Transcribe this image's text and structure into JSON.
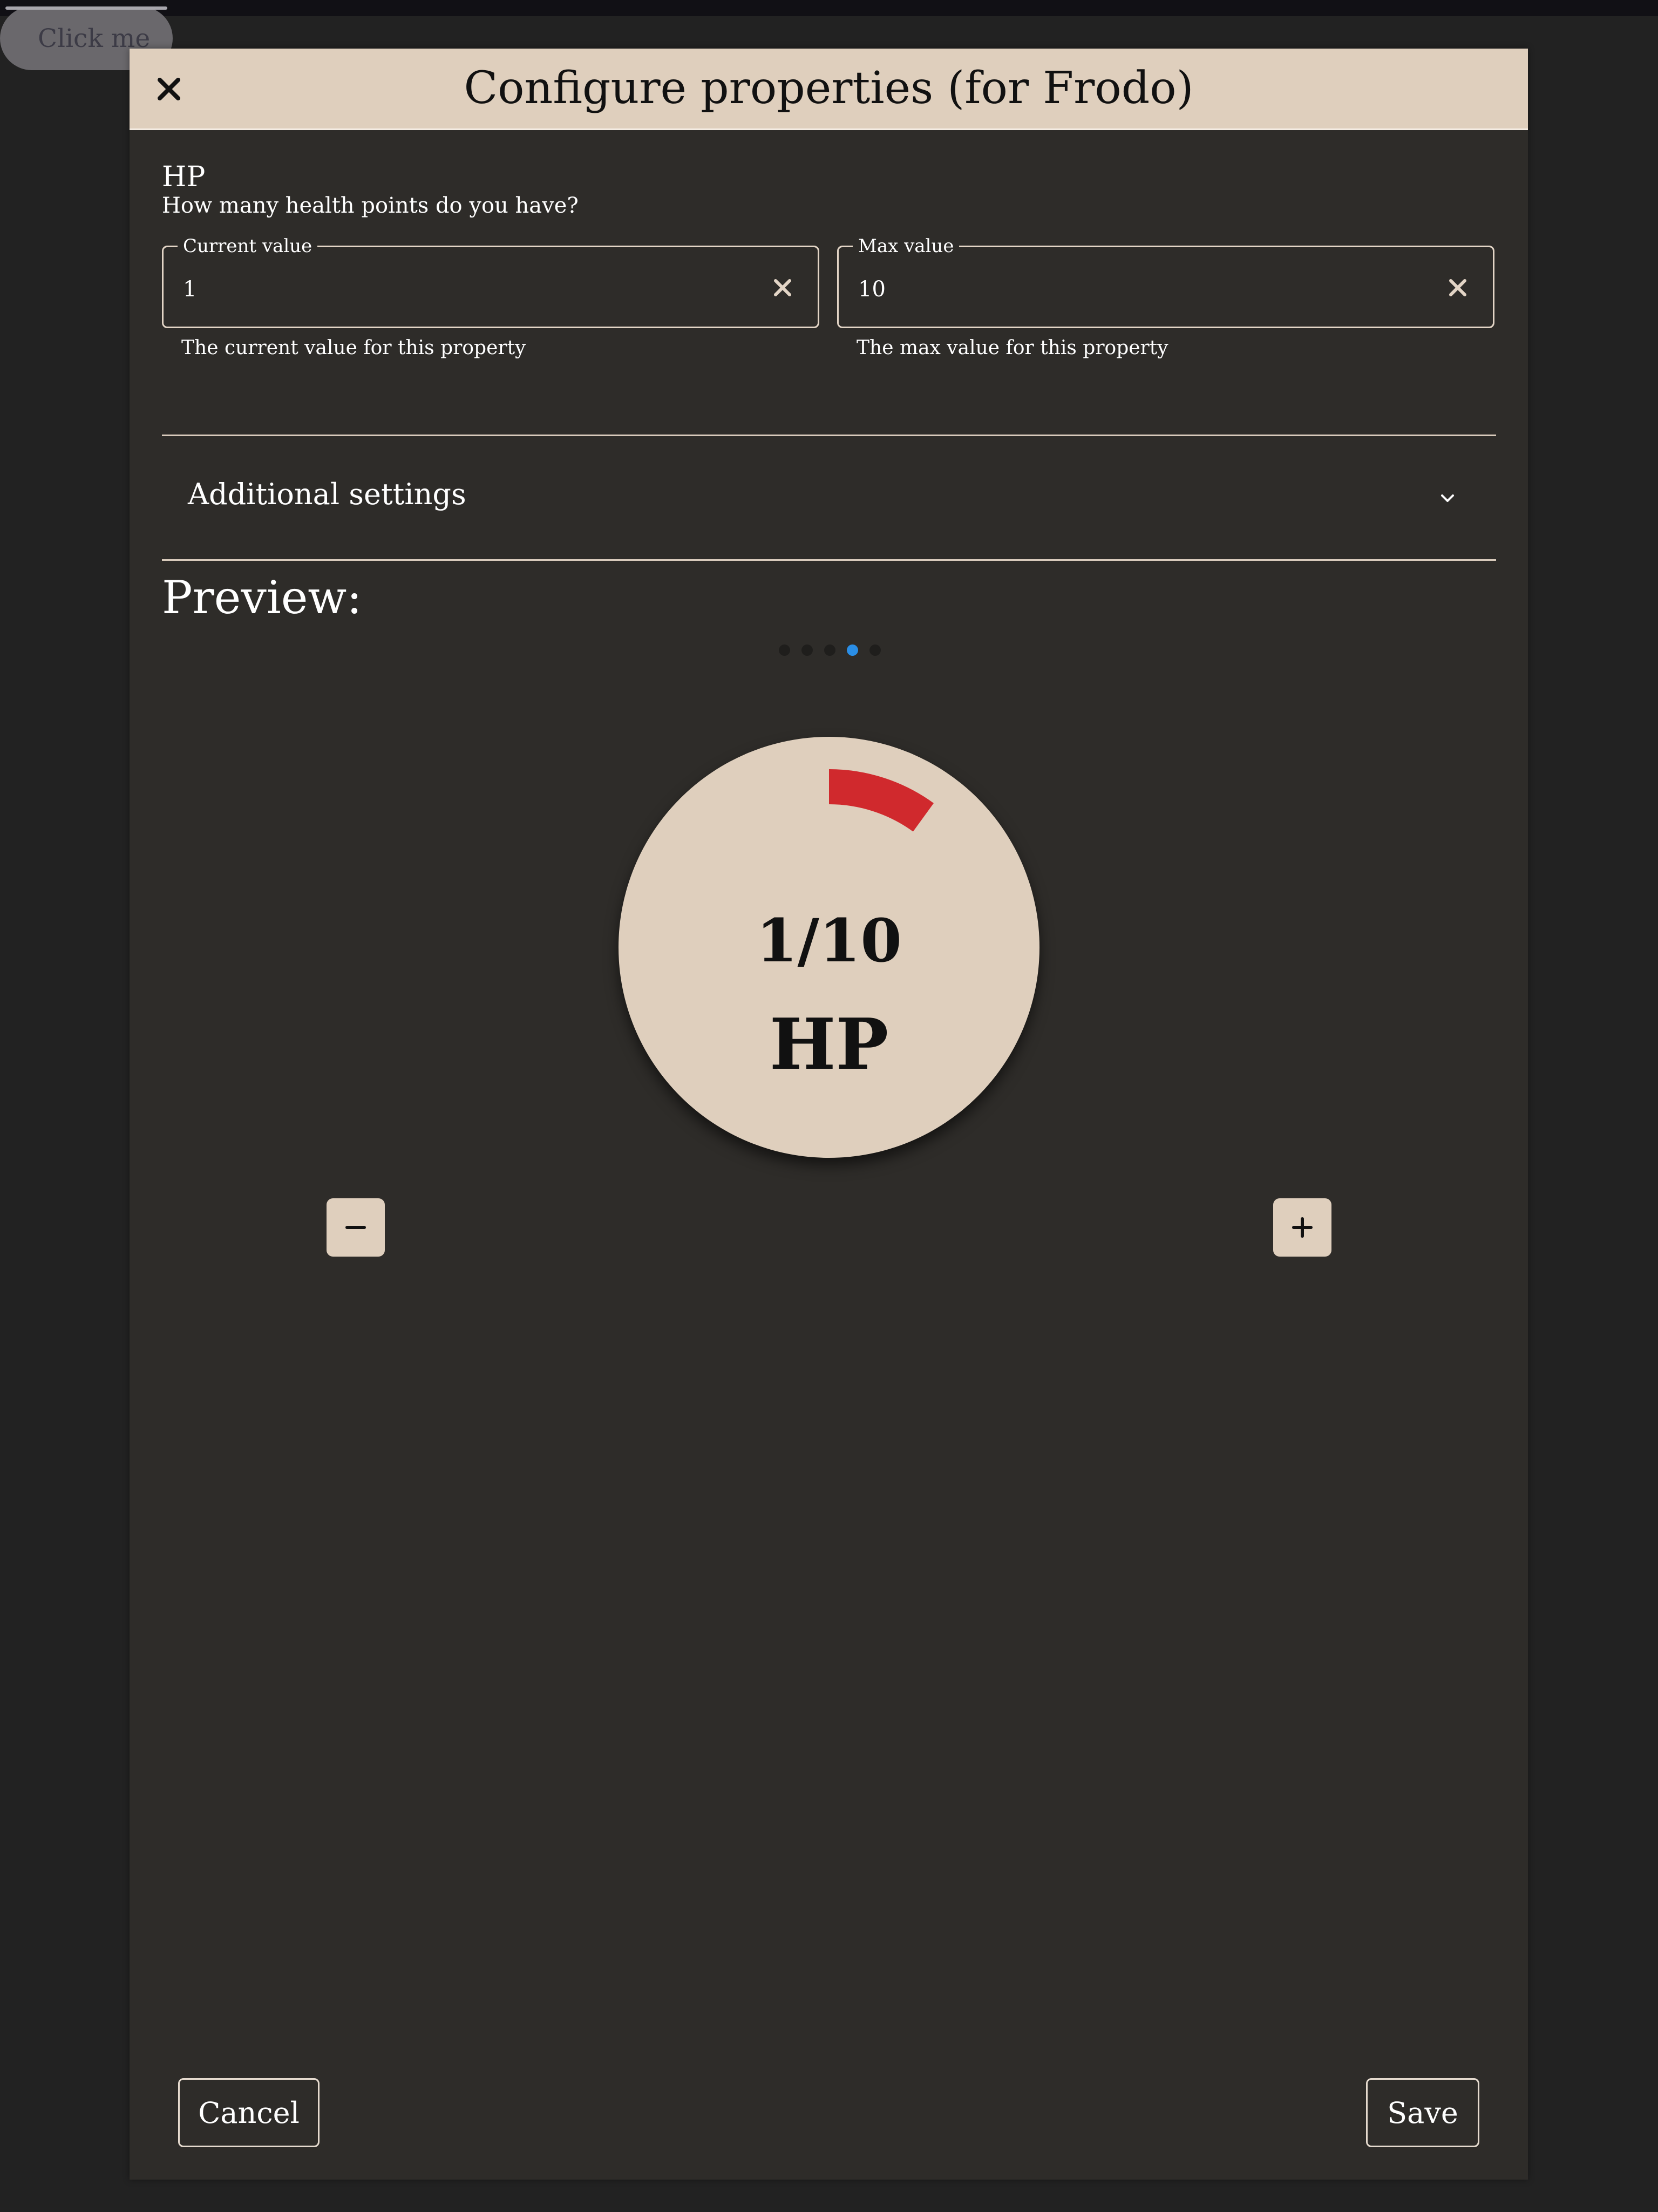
{
  "background_button": {
    "label": "Click me"
  },
  "dialog": {
    "title": "Configure properties (for Frodo)",
    "property": {
      "name": "HP",
      "description": "How many health points do you have?"
    },
    "current_field": {
      "label": "Current value",
      "value": "1",
      "helper": "The current value for this property"
    },
    "max_field": {
      "label": "Max value",
      "value": "10",
      "helper": "The max value for this property"
    },
    "accordion": {
      "label": "Additional settings"
    },
    "preview": {
      "title": "Preview:",
      "carousel": {
        "count": 5,
        "active_index": 3
      },
      "gauge": {
        "value_text": "1/10",
        "unit": "HP",
        "current": 1,
        "max": 10,
        "fill_color": "#d0292d",
        "face_color": "#dfcfbd"
      }
    },
    "footer": {
      "cancel_label": "Cancel",
      "save_label": "Save"
    }
  },
  "colors": {
    "header_bg": "#dfcfbd",
    "panel_bg": "#2e2c29",
    "page_bg": "#222222",
    "accent_dot": "#2a8ee6"
  }
}
